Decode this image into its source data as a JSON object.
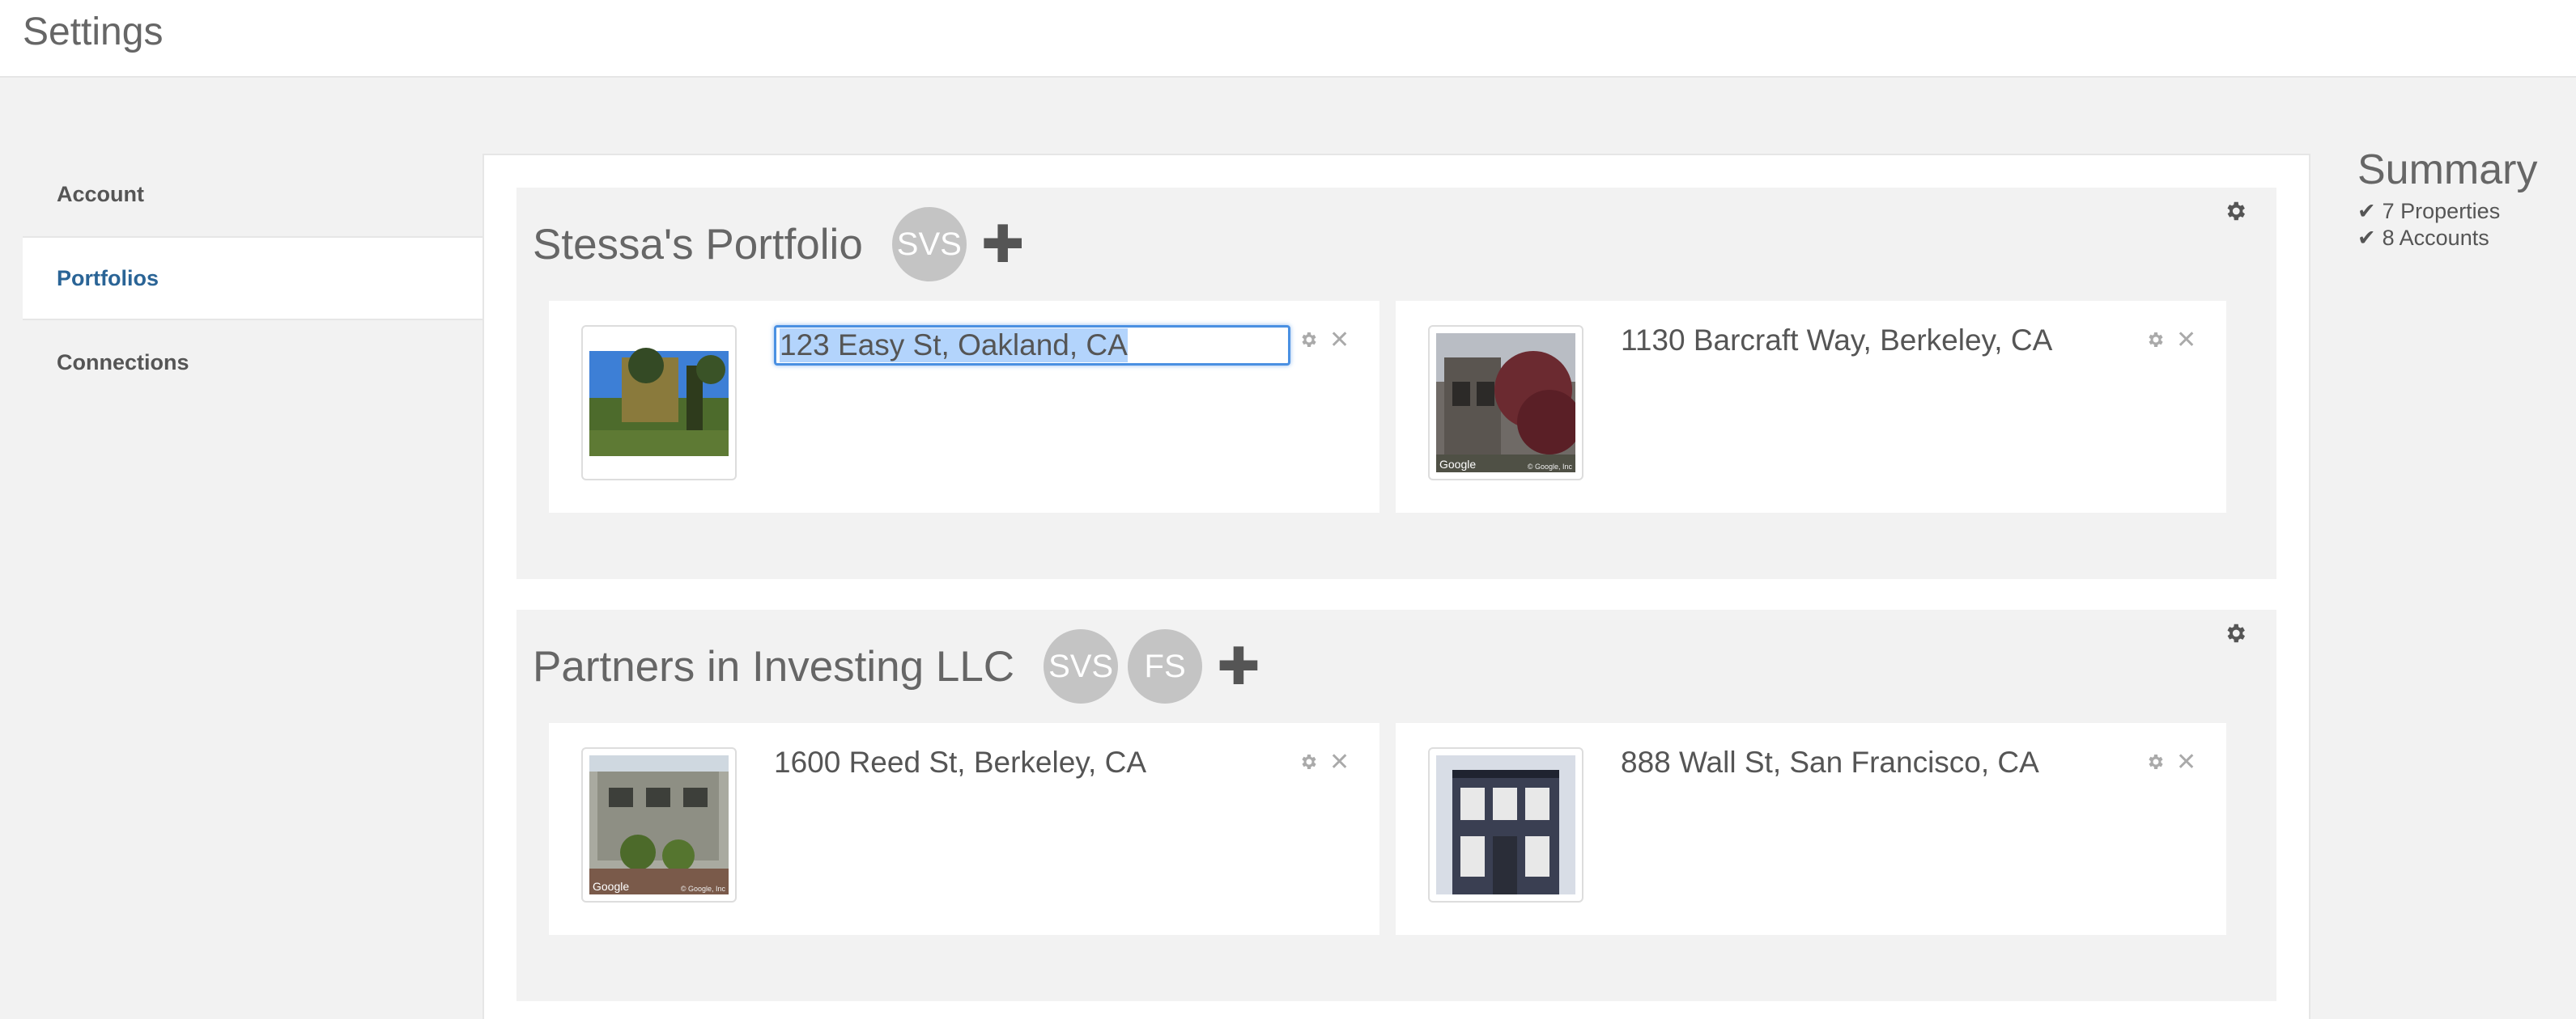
{
  "header": {
    "title": "Settings"
  },
  "sidebar": {
    "items": [
      {
        "label": "Account"
      },
      {
        "label": "Portfolios"
      },
      {
        "label": "Connections"
      }
    ]
  },
  "portfolios": [
    {
      "name": "Stessa's Portfolio",
      "members": [
        "SVS"
      ],
      "properties": [
        {
          "address": "123 Easy St, Oakland, CA",
          "editing": true
        },
        {
          "address": "1130 Barcraft Way, Berkeley, CA",
          "watermark": "Google",
          "copyright": "© Google, Inc"
        }
      ]
    },
    {
      "name": "Partners in Investing LLC",
      "members": [
        "SVS",
        "FS"
      ],
      "properties": [
        {
          "address": "1600 Reed St, Berkeley, CA",
          "watermark": "Google",
          "copyright": "© Google, Inc"
        },
        {
          "address": "888 Wall St, San Francisco, CA"
        }
      ]
    }
  ],
  "summary": {
    "title": "Summary",
    "lines": [
      "7 Properties",
      "8 Accounts"
    ]
  },
  "colors": {
    "accent": "#2a6496",
    "badge": "#c4c4c4",
    "focus": "#4a90e2",
    "selection": "#b3d4fc"
  },
  "icons": [
    "gear-icon",
    "plus-icon",
    "close-icon",
    "check-icon"
  ]
}
